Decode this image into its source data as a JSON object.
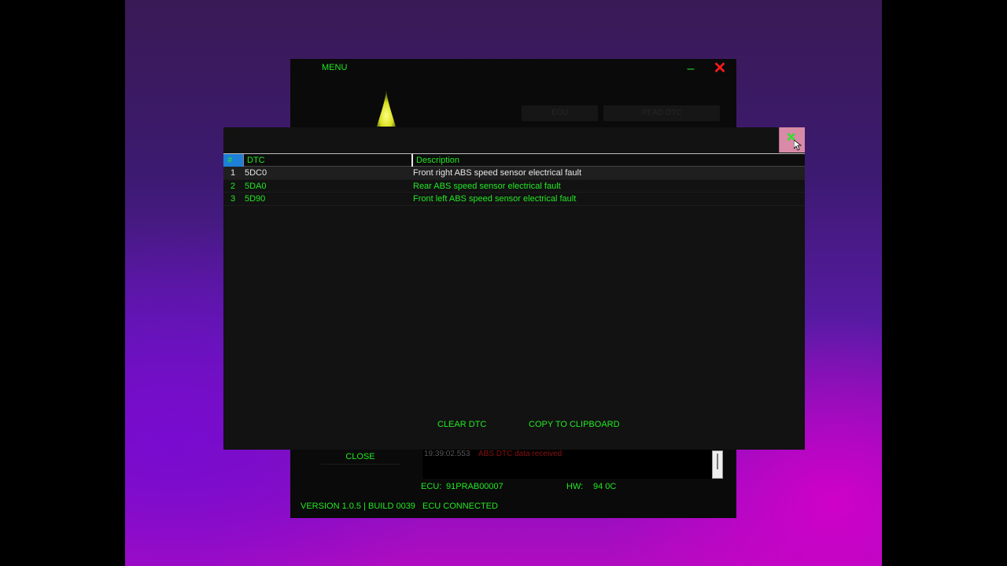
{
  "app": {
    "menu_label": "MENU",
    "minimize_glyph": "–",
    "close_glyph": "✕",
    "buttons": [
      "ECU",
      "READ DTC"
    ],
    "close_label": "CLOSE",
    "log": {
      "timestamp": "19:39:02.553",
      "message": "ABS DTC data received"
    },
    "ecu_label": "ECU:",
    "ecu_value": "91PRAB00007",
    "hw_label": "HW:",
    "hw_value": "94 0C",
    "version": "VERSION 1.0.5 | BUILD 0039",
    "status": "ECU CONNECTED"
  },
  "dtc_window": {
    "columns": {
      "num": "#",
      "dtc": "DTC",
      "description": "Description"
    },
    "rows": [
      {
        "num": "1",
        "dtc": "5DC0",
        "description": "Front right ABS speed sensor electrical fault"
      },
      {
        "num": "2",
        "dtc": "5DA0",
        "description": "Rear ABS speed sensor electrical fault"
      },
      {
        "num": "3",
        "dtc": "5D90",
        "description": "Front left ABS speed sensor electrical fault"
      }
    ],
    "clear_label": "CLEAR DTC",
    "copy_label": "COPY TO CLIPBOARD",
    "close_icon": "close-icon"
  },
  "colors": {
    "accent_green": "#22e822",
    "close_red": "#ff1a1a",
    "header_blue": "#1e7fd8",
    "close_hover_pink": "#d88aa6"
  }
}
